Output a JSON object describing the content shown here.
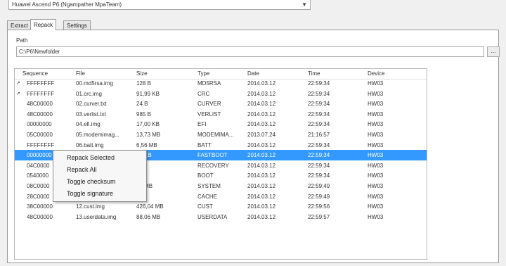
{
  "device_select": {
    "value": "Huawei Ascend P6 (Ngampather MpaTeam)"
  },
  "tabs": [
    {
      "label": "Extract"
    },
    {
      "label": "Repack"
    },
    {
      "label": "Settings"
    }
  ],
  "path": {
    "label": "Path",
    "value": "C:\\P6\\Newfolder",
    "browse_label": "..."
  },
  "table": {
    "columns": [
      "Sequence",
      "File",
      "Size",
      "Type",
      "Date",
      "Time",
      "Device"
    ],
    "rows": [
      {
        "sequence": "FFFFFFFF",
        "file": "00.md5rsa.img",
        "size": "128 B",
        "type": "MD5RSA",
        "date": "2014.03.12",
        "time": "22:59:34",
        "device": "HW03",
        "flag": true
      },
      {
        "sequence": "FFFFFFFF",
        "file": "01.crc.img",
        "size": "91,99 KB",
        "type": "CRC",
        "date": "2014.03.12",
        "time": "22:59:34",
        "device": "HW03",
        "flag": true
      },
      {
        "sequence": "48C00000",
        "file": "02.curver.txt",
        "size": "24 B",
        "type": "CURVER",
        "date": "2014.03.12",
        "time": "22:59:34",
        "device": "HW03",
        "flag": false
      },
      {
        "sequence": "48C00000",
        "file": "03.verlist.txt",
        "size": "985 B",
        "type": "VERLIST",
        "date": "2014.03.12",
        "time": "22:59:34",
        "device": "HW03",
        "flag": false
      },
      {
        "sequence": "00000000",
        "file": "04.efi.img",
        "size": "17,00 KB",
        "type": "EFI",
        "date": "2014.03.12",
        "time": "22:59:34",
        "device": "HW03",
        "flag": false
      },
      {
        "sequence": "05C00000",
        "file": "05.modemimag...",
        "size": "13,73 MB",
        "type": "MODEMIMA...",
        "date": "2013.07.24",
        "time": "21:16:57",
        "device": "HW03",
        "flag": false
      },
      {
        "sequence": "FFFFFFFF",
        "file": "06.batt.img",
        "size": "6,56 MB",
        "type": "BATT",
        "date": "2014.03.12",
        "time": "22:59:34",
        "device": "HW03",
        "flag": false
      },
      {
        "sequence": "00000000",
        "file": "",
        "size": "60 KB",
        "type": "FASTBOOT",
        "date": "2014.03.12",
        "time": "22:59:34",
        "device": "HW03",
        "flag": false,
        "selected": true
      },
      {
        "sequence": "04C0000",
        "file": "",
        "size": "MB",
        "type": "RECOVERY",
        "date": "2014.03.12",
        "time": "22:59:34",
        "device": "HW03",
        "flag": false
      },
      {
        "sequence": "0540000",
        "file": "",
        "size": "MB",
        "type": "BOOT",
        "date": "2014.03.12",
        "time": "22:59:34",
        "device": "HW03",
        "flag": false
      },
      {
        "sequence": "08C0000",
        "file": "",
        "size": "35 MB",
        "type": "SYSTEM",
        "date": "2014.03.12",
        "time": "22:59:49",
        "device": "HW03",
        "flag": false
      },
      {
        "sequence": "28C0000",
        "file": "",
        "size": "MB",
        "type": "CACHE",
        "date": "2014.03.12",
        "time": "22:59:49",
        "device": "HW03",
        "flag": false
      },
      {
        "sequence": "38C00000",
        "file": "12.cust.img",
        "size": "426,04 MB",
        "type": "CUST",
        "date": "2014.03.12",
        "time": "22:59:56",
        "device": "HW03",
        "flag": false
      },
      {
        "sequence": "48C00000",
        "file": "13.userdata.img",
        "size": "88,06 MB",
        "type": "USERDATA",
        "date": "2014.03.12",
        "time": "22:59:57",
        "device": "HW03",
        "flag": false
      }
    ]
  },
  "context_menu": {
    "items": [
      {
        "label": "Repack Selected"
      },
      {
        "label": "Repack All"
      },
      {
        "label": "Toggle checksum"
      },
      {
        "label": "Toggle signature"
      }
    ]
  },
  "icons": {
    "flag_icon": "pin-icon",
    "dropdown_icon": "chevron-down-icon"
  },
  "colors": {
    "selection": "#3399ff",
    "flag": "#c89a2a"
  }
}
